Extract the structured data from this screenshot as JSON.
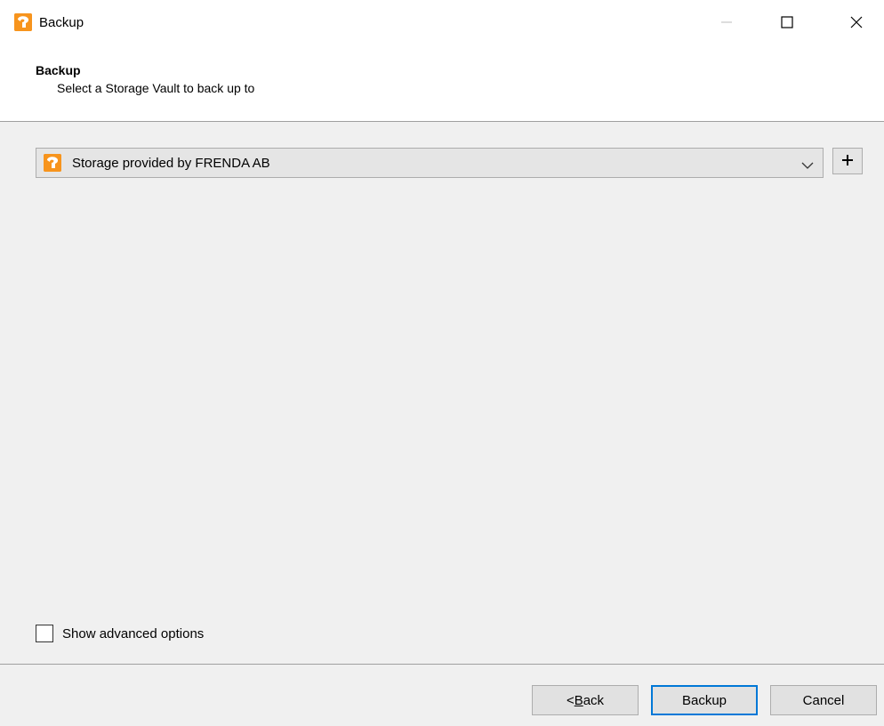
{
  "window": {
    "title": "Backup",
    "app_icon": "app-logo-icon",
    "controls": [
      "minimize-icon",
      "maximize-icon",
      "close-icon"
    ]
  },
  "header": {
    "title": "Backup",
    "subtitle": "Select a Storage Vault to back up to"
  },
  "vault_select": {
    "selected": "Storage provided by FRENDA AB",
    "icon": "storage-vault-icon",
    "add_label": "+"
  },
  "options": {
    "show_advanced_label": "Show advanced options",
    "show_advanced_checked": false
  },
  "footer": {
    "back_prefix": "< ",
    "back_mnemonic": "B",
    "back_suffix": "ack",
    "backup_label": "Backup",
    "cancel_label": "Cancel"
  },
  "colors": {
    "accent": "#0078d7",
    "brand": "#f7941d"
  }
}
